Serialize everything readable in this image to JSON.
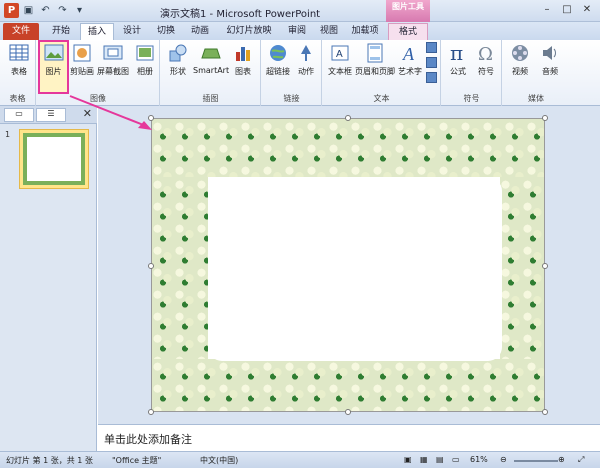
{
  "titlebar": {
    "app_icon": "P",
    "title": "演示文稿1 - Microsoft PowerPoint",
    "context_tools": "图片工具",
    "qat_icons": [
      "save-icon",
      "undo-icon",
      "redo-icon",
      "qat-menu-icon"
    ]
  },
  "tabs": [
    {
      "label": "文件"
    },
    {
      "label": "开始"
    },
    {
      "label": "插入"
    },
    {
      "label": "设计"
    },
    {
      "label": "切换"
    },
    {
      "label": "动画"
    },
    {
      "label": "幻灯片放映"
    },
    {
      "label": "审阅"
    },
    {
      "label": "视图"
    },
    {
      "label": "加载项"
    },
    {
      "label": "格式"
    }
  ],
  "groups": {
    "tables": {
      "label": "表格",
      "buttons": [
        "表格"
      ]
    },
    "images": {
      "label": "图像",
      "buttons": [
        "图片",
        "剪贴画",
        "屏幕截图",
        "相册"
      ]
    },
    "illustrations": {
      "label": "插图",
      "buttons": [
        "形状",
        "SmartArt",
        "图表"
      ]
    },
    "links": {
      "label": "链接",
      "buttons": [
        "超链接",
        "动作"
      ]
    },
    "text": {
      "label": "文本",
      "buttons": [
        "文本框",
        "页眉和页脚",
        "艺术字"
      ]
    },
    "symbols": {
      "label": "符号",
      "buttons": [
        "公式",
        "符号"
      ]
    },
    "media": {
      "label": "媒体",
      "buttons": [
        "视频",
        "音频"
      ]
    }
  },
  "pane": {
    "slide_number": "1"
  },
  "notes": {
    "placeholder": "单击此处添加备注"
  },
  "status": {
    "slide": "幻灯片 第 1 张，共 1 张",
    "theme": "\"Office 主题\"",
    "language": "中文(中国)",
    "zoom": "61%"
  },
  "colors": {
    "accent_pink": "#e5379b",
    "file_tab": "#c84228"
  }
}
